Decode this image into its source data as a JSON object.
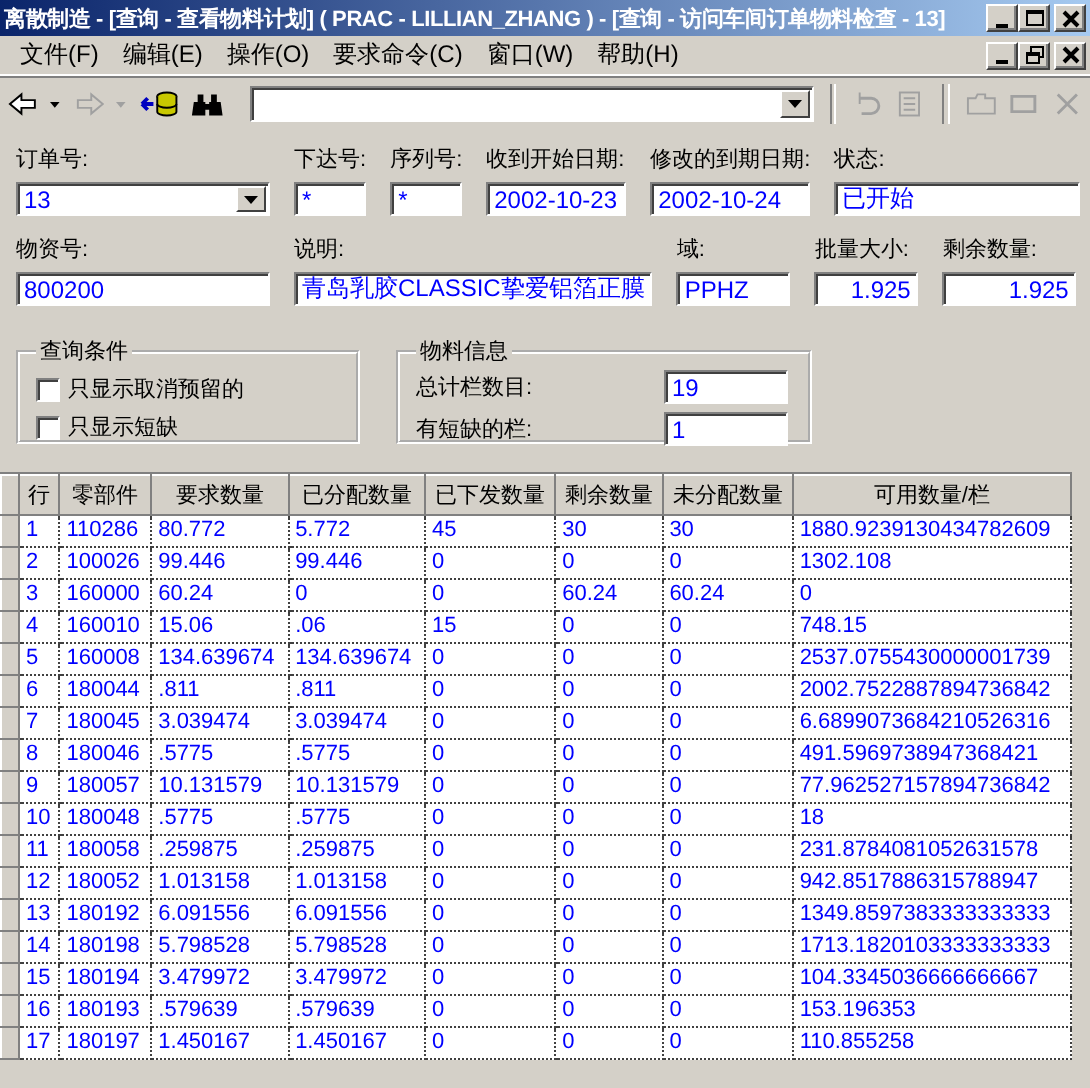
{
  "window": {
    "title": "离散制造 - [查询 - 查看物料计划] ( PRAC - LILLIAN_ZHANG ) - [查询 - 访问车间订单物料检查 - 13]"
  },
  "menu": [
    {
      "label": "文件(F)"
    },
    {
      "label": "编辑(E)"
    },
    {
      "label": "操作(O)"
    },
    {
      "label": "要求命令(C)"
    },
    {
      "label": "窗口(W)"
    },
    {
      "label": "帮助(H)"
    }
  ],
  "toolbar": {
    "left": [
      {
        "kind": "back",
        "disabled": false
      },
      {
        "kind": "caret",
        "disabled": false
      },
      {
        "kind": "forward",
        "disabled": true
      },
      {
        "kind": "caret",
        "disabled": true
      },
      {
        "kind": "database",
        "disabled": false
      },
      {
        "kind": "binoculars",
        "disabled": false
      }
    ],
    "right": [
      {
        "kind": "undo",
        "disabled": true
      },
      {
        "kind": "save",
        "disabled": true
      },
      {
        "kind": "new",
        "disabled": true
      },
      {
        "kind": "clear",
        "disabled": true
      },
      {
        "kind": "delete",
        "disabled": true
      }
    ]
  },
  "header_fields": [
    [
      {
        "label": "订单号:",
        "value": "13",
        "kind": "combo"
      },
      {
        "label": "下达号:",
        "value": "*",
        "kind": "text"
      },
      {
        "label": "序列号:",
        "value": "*",
        "kind": "text"
      },
      {
        "label": "收到开始日期:",
        "value": "2002-10-23",
        "kind": "text"
      },
      {
        "label": "修改的到期日期:",
        "value": "2002-10-24",
        "kind": "text"
      },
      {
        "label": "状态:",
        "value": "已开始",
        "kind": "text"
      }
    ],
    [
      {
        "label": "物资号:",
        "value": "800200",
        "kind": "text"
      },
      {
        "label": "说明:",
        "value": "青岛乳胶CLASSIC挚爱铝箔正膜",
        "kind": "text"
      },
      {
        "label": "域:",
        "value": "PPHZ",
        "kind": "text"
      },
      {
        "label": "批量大小:",
        "value": "1.925",
        "kind": "number"
      },
      {
        "label": "剩余数量:",
        "value": "1.925",
        "kind": "number"
      }
    ]
  ],
  "query_conditions": {
    "title": "查询条件",
    "options": [
      {
        "label": "只显示取消预留的",
        "checked": false
      },
      {
        "label": "只显示短缺",
        "checked": false
      }
    ]
  },
  "material_info": {
    "title": "物料信息",
    "fields": [
      {
        "label": "总计栏数目:",
        "value": "19"
      },
      {
        "label": "有短缺的栏:",
        "value": "1"
      }
    ]
  },
  "table": {
    "columns": [
      "行",
      "零部件",
      "要求数量",
      "已分配数量",
      "已下发数量",
      "剩余数量",
      "未分配数量",
      "可用数量/栏"
    ],
    "rows": [
      [
        "1",
        "110286",
        "80.772",
        "5.772",
        "45",
        "30",
        "30",
        "1880.9239130434782609"
      ],
      [
        "2",
        "100026",
        "99.446",
        "99.446",
        "0",
        "0",
        "0",
        "1302.108"
      ],
      [
        "3",
        "160000",
        "60.24",
        "0",
        "0",
        "60.24",
        "60.24",
        "0"
      ],
      [
        "4",
        "160010",
        "15.06",
        ".06",
        "15",
        "0",
        "0",
        "748.15"
      ],
      [
        "5",
        "160008",
        "134.639674",
        "134.639674",
        "0",
        "0",
        "0",
        "2537.0755430000001739"
      ],
      [
        "6",
        "180044",
        ".811",
        ".811",
        "0",
        "0",
        "0",
        "2002.7522887894736842"
      ],
      [
        "7",
        "180045",
        "3.039474",
        "3.039474",
        "0",
        "0",
        "0",
        "6.6899073684210526316"
      ],
      [
        "8",
        "180046",
        ".5775",
        ".5775",
        "0",
        "0",
        "0",
        "491.5969738947368421"
      ],
      [
        "9",
        "180057",
        "10.131579",
        "10.131579",
        "0",
        "0",
        "0",
        "77.962527157894736842"
      ],
      [
        "10",
        "180048",
        ".5775",
        ".5775",
        "0",
        "0",
        "0",
        "18"
      ],
      [
        "11",
        "180058",
        ".259875",
        ".259875",
        "0",
        "0",
        "0",
        "231.8784081052631578"
      ],
      [
        "12",
        "180052",
        "1.013158",
        "1.013158",
        "0",
        "0",
        "0",
        "942.8517886315788947"
      ],
      [
        "13",
        "180192",
        "6.091556",
        "6.091556",
        "0",
        "0",
        "0",
        "1349.8597383333333333"
      ],
      [
        "14",
        "180198",
        "5.798528",
        "5.798528",
        "0",
        "0",
        "0",
        "1713.1820103333333333"
      ],
      [
        "15",
        "180194",
        "3.479972",
        "3.479972",
        "0",
        "0",
        "0",
        "104.3345036666666667"
      ],
      [
        "16",
        "180193",
        ".579639",
        ".579639",
        "0",
        "0",
        "0",
        "153.196353"
      ],
      [
        "17",
        "180197",
        "1.450167",
        "1.450167",
        "0",
        "0",
        "0",
        "110.855258"
      ]
    ]
  }
}
